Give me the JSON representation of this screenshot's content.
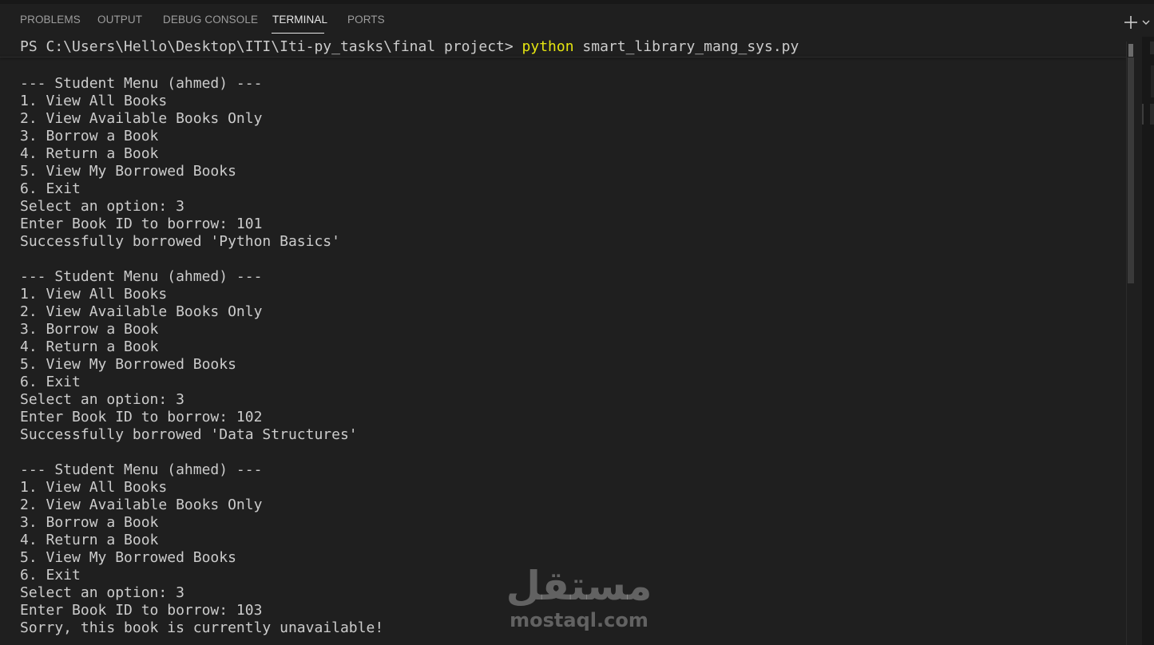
{
  "colors": {
    "background": "#1f1f1f",
    "text": "#cccccc",
    "active_tab": "#e7e7e7",
    "inactive_tab": "#9d9d9d",
    "command_highlight": "#e5e510"
  },
  "panel": {
    "tabs": [
      {
        "label": "PROBLEMS",
        "active": false
      },
      {
        "label": "OUTPUT",
        "active": false
      },
      {
        "label": "DEBUG CONSOLE",
        "active": false
      },
      {
        "label": "TERMINAL",
        "active": true
      },
      {
        "label": "PORTS",
        "active": false
      }
    ],
    "actions": {
      "new_terminal_icon": "plus-icon",
      "dropdown_icon": "chevron-down-icon"
    }
  },
  "terminal": {
    "prompt": "PS C:\\Users\\Hello\\Desktop\\ITI\\Iti-py_tasks\\final project> ",
    "command": "python",
    "args": " smart_library_mang_sys.py",
    "lines": [
      "",
      "--- Student Menu (ahmed) ---",
      "1. View All Books",
      "2. View Available Books Only",
      "3. Borrow a Book",
      "4. Return a Book",
      "5. View My Borrowed Books",
      "6. Exit",
      "Select an option: 3",
      "Enter Book ID to borrow: 101",
      "Successfully borrowed 'Python Basics'",
      "",
      "--- Student Menu (ahmed) ---",
      "1. View All Books",
      "2. View Available Books Only",
      "3. Borrow a Book",
      "4. Return a Book",
      "5. View My Borrowed Books",
      "6. Exit",
      "Select an option: 3",
      "Enter Book ID to borrow: 102",
      "Successfully borrowed 'Data Structures'",
      "",
      "--- Student Menu (ahmed) ---",
      "1. View All Books",
      "2. View Available Books Only",
      "3. Borrow a Book",
      "4. Return a Book",
      "5. View My Borrowed Books",
      "6. Exit",
      "Select an option: 3",
      "Enter Book ID to borrow: 103",
      "Sorry, this book is currently unavailable!"
    ]
  },
  "watermark": {
    "arabic": "مستقل",
    "latin": "mostaql.com"
  }
}
